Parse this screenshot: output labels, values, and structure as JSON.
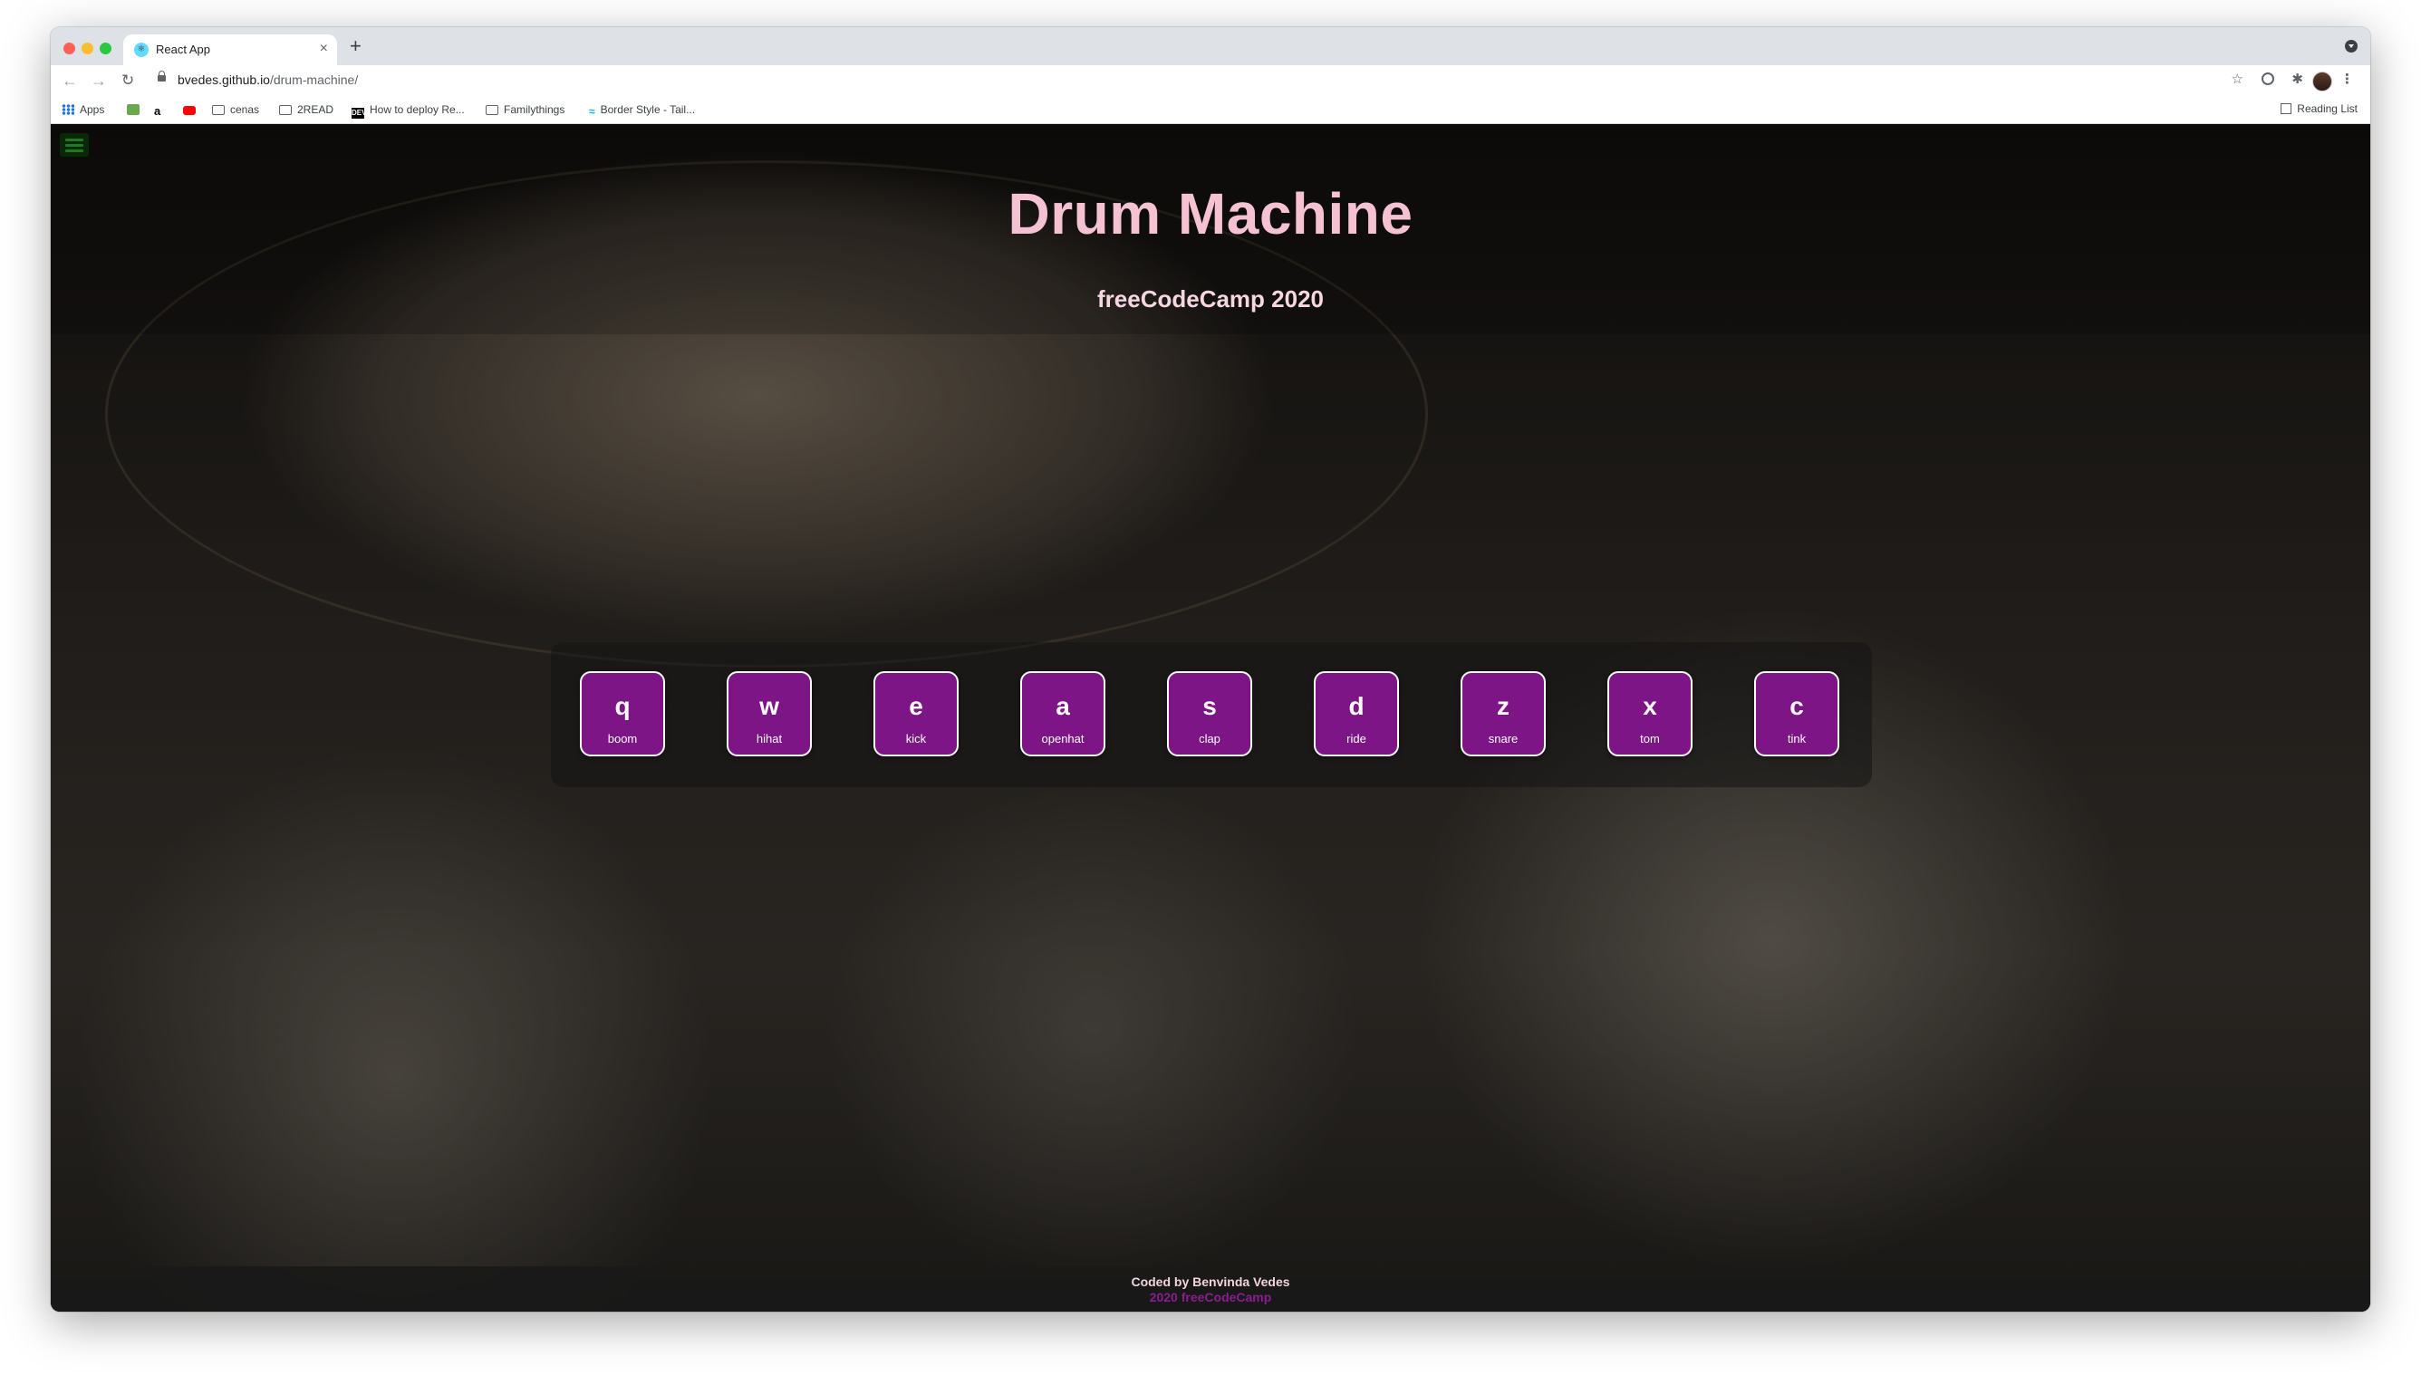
{
  "browser": {
    "tab_title": "React App",
    "tab_close": "×",
    "new_tab": "+",
    "url_host": "bvedes.github.io",
    "url_path": "/drum-machine/",
    "nav_back": "←",
    "nav_forward": "→",
    "nav_reload": "↻",
    "star_icon": "☆",
    "extensions_icon": "✱",
    "menu_icon": "⋮",
    "bookmarks": [
      {
        "label": "Apps",
        "icon": "apps-icon"
      },
      {
        "label": "",
        "icon": "green-square-icon"
      },
      {
        "label": "a",
        "icon": "amazon-icon"
      },
      {
        "label": "",
        "icon": "youtube-icon"
      },
      {
        "label": "cenas",
        "icon": "folder-icon"
      },
      {
        "label": "2READ",
        "icon": "folder-icon"
      },
      {
        "label": "How to deploy Re...",
        "icon": "dev-icon"
      },
      {
        "label": "Familythings",
        "icon": "folder-icon"
      },
      {
        "label": "Border Style - Tail...",
        "icon": "tailwind-icon"
      }
    ],
    "reading_list": "Reading List"
  },
  "page": {
    "title": "Drum Machine",
    "subtitle": "freeCodeCamp 2020",
    "pads": [
      {
        "key": "q",
        "sound": "boom"
      },
      {
        "key": "w",
        "sound": "hihat"
      },
      {
        "key": "e",
        "sound": "kick"
      },
      {
        "key": "a",
        "sound": "openhat"
      },
      {
        "key": "s",
        "sound": "clap"
      },
      {
        "key": "d",
        "sound": "ride"
      },
      {
        "key": "z",
        "sound": "snare"
      },
      {
        "key": "x",
        "sound": "tom"
      },
      {
        "key": "c",
        "sound": "tink"
      }
    ],
    "footer": {
      "credit": "Coded by Benvinda Vedes",
      "year": "2020 freeCodeCamp"
    }
  },
  "colors": {
    "title": "#f4c2d2",
    "pad_background": "#7d1587",
    "footer_year": "#8b1d8f"
  }
}
